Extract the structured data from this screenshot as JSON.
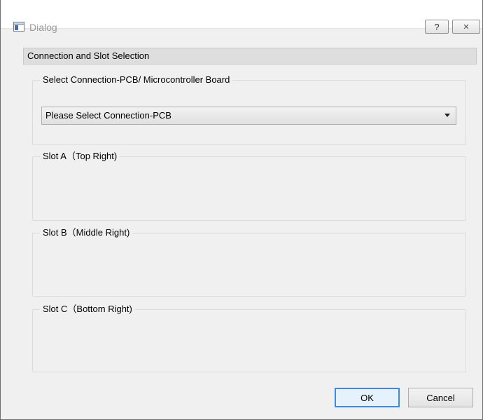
{
  "window": {
    "title": "Dialog",
    "help_label": "?",
    "close_label": "✕"
  },
  "section": {
    "header": "Connection and Slot Selection"
  },
  "connection": {
    "group_title": "Select Connection-PCB/ Microcontroller Board",
    "combo_value": "Please Select Connection-PCB"
  },
  "slots": [
    {
      "title": "Slot A（Top Right)"
    },
    {
      "title": "Slot B（Middle Right)"
    },
    {
      "title": "Slot C（Bottom Right)"
    }
  ],
  "buttons": {
    "ok_label": "OK",
    "cancel_label": "Cancel"
  },
  "colors": {
    "focus_border": "#3c8ae0",
    "title_text": "#9a9a9a"
  }
}
